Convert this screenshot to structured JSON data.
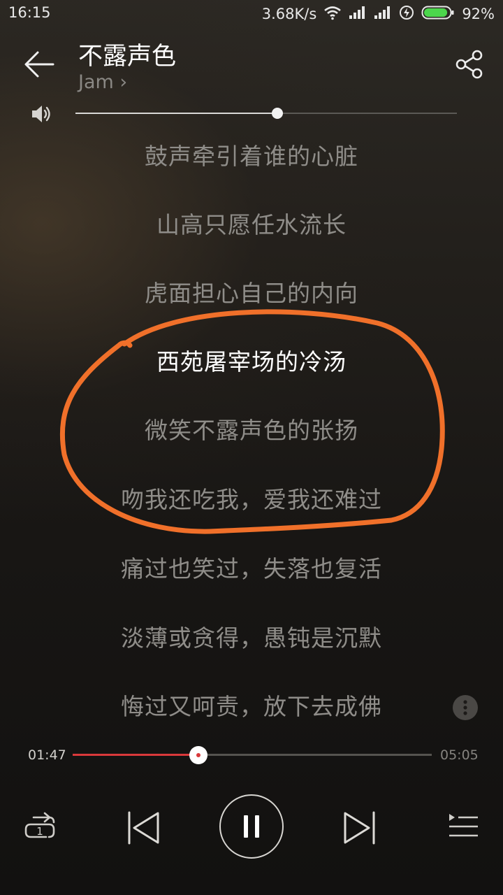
{
  "status_bar": {
    "time": "16:15",
    "network_speed": "3.68K/s",
    "battery_percent": "92%",
    "battery_level": 0.92,
    "icons": [
      "wifi-icon",
      "signal-icon",
      "signal-icon",
      "charging-icon",
      "battery-icon"
    ]
  },
  "header": {
    "title": "不露声色",
    "artist": "Jam",
    "artist_chevron": "›",
    "back_icon": "arrow-left-icon",
    "share_icon": "share-icon"
  },
  "volume": {
    "icon": "speaker-icon",
    "level": 0.53
  },
  "lyrics": {
    "lines": [
      "鼓声牵引着谁的心脏",
      "山高只愿任水流长",
      "虎面担心自己的内向",
      "西苑屠宰场的冷汤",
      "微笑不露声色的张扬",
      "吻我还吃我，爱我还难过",
      "痛过也笑过，失落也复活",
      "淡薄或贪得，愚钝是沉默",
      "悔过又呵责，放下去成佛"
    ],
    "current_index": 3
  },
  "annotation": {
    "color": "#f0702a"
  },
  "playback": {
    "elapsed": "01:47",
    "total": "05:05",
    "progress": 0.35,
    "accent_color": "#d9393b"
  },
  "controls": {
    "repeat_badge": "1",
    "icons": [
      "repeat-one-icon",
      "previous-icon",
      "pause-icon",
      "next-icon",
      "playlist-icon"
    ]
  }
}
